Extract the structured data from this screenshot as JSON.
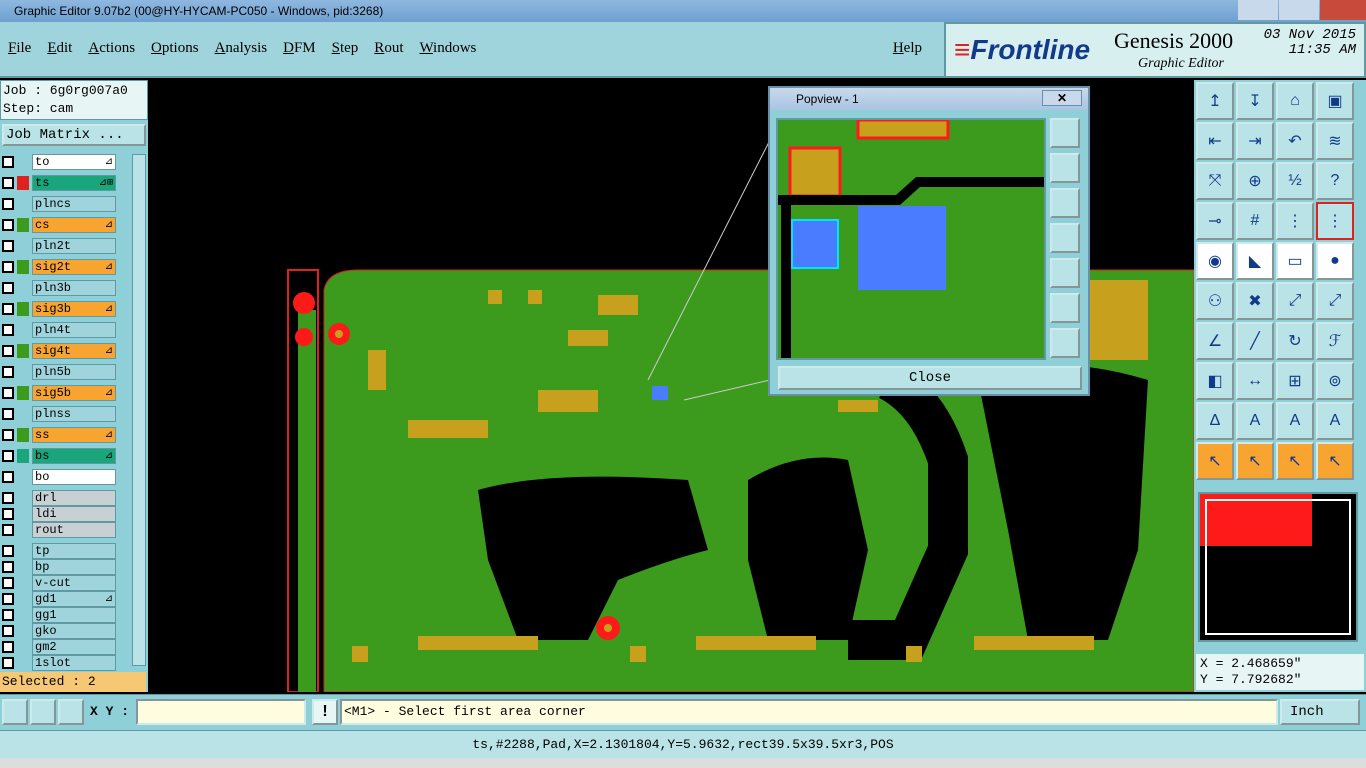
{
  "window": {
    "title": "Graphic Editor 9.07b2 (00@HY-HYCAM-PC050 - Windows, pid:3268)"
  },
  "menu": {
    "items": [
      "File",
      "Edit",
      "Actions",
      "Options",
      "Analysis",
      "DFM",
      "Step",
      "Rout",
      "Windows"
    ],
    "help": "Help"
  },
  "branding": {
    "logo": "Frontline",
    "product": "Genesis 2000",
    "subtitle": "Graphic Editor",
    "date": "03 Nov 2015",
    "time": "11:35 AM"
  },
  "job": {
    "job_line": "Job : 6g0rg007a0",
    "step_line": "Step: cam",
    "matrix_button": "Job Matrix ..."
  },
  "layers": [
    {
      "name": "to",
      "color": "#ffffff",
      "flag": "⊿"
    },
    {
      "name": "ts",
      "color": "#1aa57a",
      "flag": "⊿⊞",
      "active": true
    },
    {
      "name": "plncs",
      "color": "#9fd4dc",
      "flag": ""
    },
    {
      "name": "cs",
      "color": "#f7a430",
      "flag": "⊿"
    },
    {
      "name": "pln2t",
      "color": "#9fd4dc",
      "flag": ""
    },
    {
      "name": "sig2t",
      "color": "#f7a430",
      "flag": "⊿"
    },
    {
      "name": "pln3b",
      "color": "#9fd4dc",
      "flag": ""
    },
    {
      "name": "sig3b",
      "color": "#f7a430",
      "flag": "⊿"
    },
    {
      "name": "pln4t",
      "color": "#9fd4dc",
      "flag": ""
    },
    {
      "name": "sig4t",
      "color": "#f7a430",
      "flag": "⊿"
    },
    {
      "name": "pln5b",
      "color": "#9fd4dc",
      "flag": ""
    },
    {
      "name": "sig5b",
      "color": "#f7a430",
      "flag": "⊿"
    },
    {
      "name": "plnss",
      "color": "#9fd4dc",
      "flag": ""
    },
    {
      "name": "ss",
      "color": "#f7a430",
      "flag": "⊿"
    },
    {
      "name": "bs",
      "color": "#1aa57a",
      "flag": "⊿"
    },
    {
      "name": "bo",
      "color": "#ffffff",
      "flag": ""
    },
    {
      "name": "drl",
      "color": "#c8d0d4",
      "flag": ""
    },
    {
      "name": "ldi",
      "color": "#c8d0d4",
      "flag": ""
    },
    {
      "name": "rout",
      "color": "#c8d0d4",
      "flag": ""
    },
    {
      "name": "tp",
      "color": "#9fd4dc",
      "flag": ""
    },
    {
      "name": "bp",
      "color": "#9fd4dc",
      "flag": ""
    },
    {
      "name": "v-cut",
      "color": "#9fd4dc",
      "flag": ""
    },
    {
      "name": "gd1",
      "color": "#9fd4dc",
      "flag": "⊿"
    },
    {
      "name": "gg1",
      "color": "#9fd4dc",
      "flag": ""
    },
    {
      "name": "gko",
      "color": "#9fd4dc",
      "flag": ""
    },
    {
      "name": "gm2",
      "color": "#9fd4dc",
      "flag": ""
    },
    {
      "name": "1slot",
      "color": "#9fd4dc",
      "flag": ""
    }
  ],
  "selected": "Selected : 2",
  "popview": {
    "title": "Popview - 1",
    "close_label": "Close",
    "close_x": "✕"
  },
  "coords": {
    "x": "X = 2.468659\"",
    "y": "Y = 7.792682\""
  },
  "bottom": {
    "xy_label": "X Y :",
    "xy_value": "",
    "warn": "!",
    "prompt": "<M1> - Select first area corner",
    "units": "Inch"
  },
  "status": "ts,#2288,Pad,X=2.1301804,Y=5.9632,rect39.5x39.5xr3,POS",
  "colors": {
    "board_green": "#3c9a1c",
    "copper": "#c7a01e",
    "highlight": "#4a7cff",
    "selection_red": "#ff1a1a",
    "panel": "#8fd0d8"
  }
}
